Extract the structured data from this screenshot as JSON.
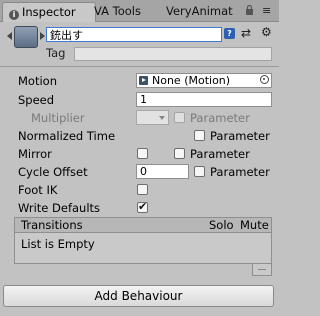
{
  "tabs": [
    {
      "label": "Inspector",
      "icon": "info-icon"
    },
    {
      "label": "VA Tools"
    },
    {
      "label": "VeryAnimat"
    }
  ],
  "header": {
    "name": "銃出す",
    "tag_label": "Tag",
    "tag_value": ""
  },
  "properties": {
    "motion_label": "Motion",
    "motion_value": "None (Motion)",
    "speed_label": "Speed",
    "speed_value": "1",
    "multiplier_label": "Multiplier",
    "multiplier_param_label": "Parameter",
    "normalized_time_label": "Normalized Time",
    "normalized_time_param_label": "Parameter",
    "mirror_label": "Mirror",
    "mirror_param_label": "Parameter",
    "cycle_offset_label": "Cycle Offset",
    "cycle_offset_value": "0",
    "cycle_offset_param_label": "Parameter",
    "foot_ik_label": "Foot IK",
    "foot_ik_checked": false,
    "write_defaults_label": "Write Defaults",
    "write_defaults_checked": true
  },
  "transitions": {
    "title": "Transitions",
    "solo_label": "Solo",
    "mute_label": "Mute",
    "empty_text": "List is Empty"
  },
  "add_behaviour_label": "Add Behaviour"
}
